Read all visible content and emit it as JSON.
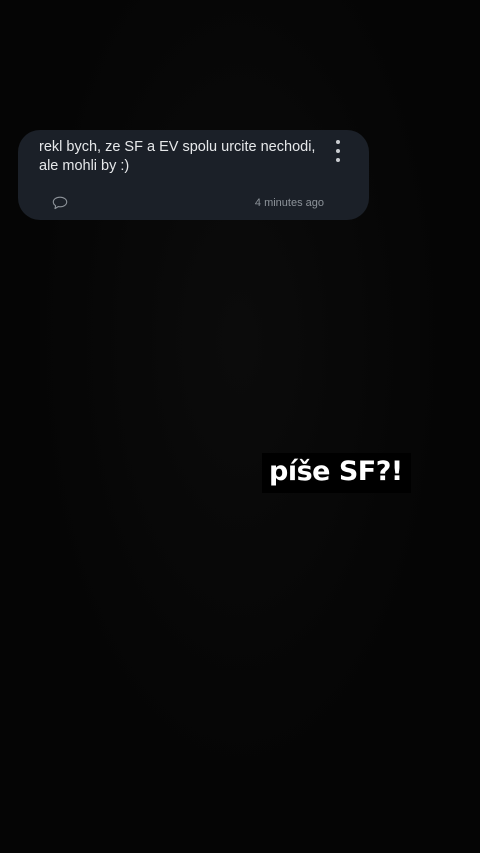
{
  "comment": {
    "text": "rekl bych, ze SF a EV spolu urcite nechodi, ale mohli by :)",
    "timestamp": "4 minutes ago",
    "reply_icon": "speech-bubble-icon",
    "more_icon": "vertical-dots-icon"
  },
  "overlay": {
    "caption": "píše SF?!"
  },
  "colors": {
    "background": "#060606",
    "card": "#1b2028",
    "comment_text": "#e6e8ea",
    "timestamp_text": "#8d939a",
    "caption_bg": "#000000",
    "caption_text": "#ffffff"
  }
}
